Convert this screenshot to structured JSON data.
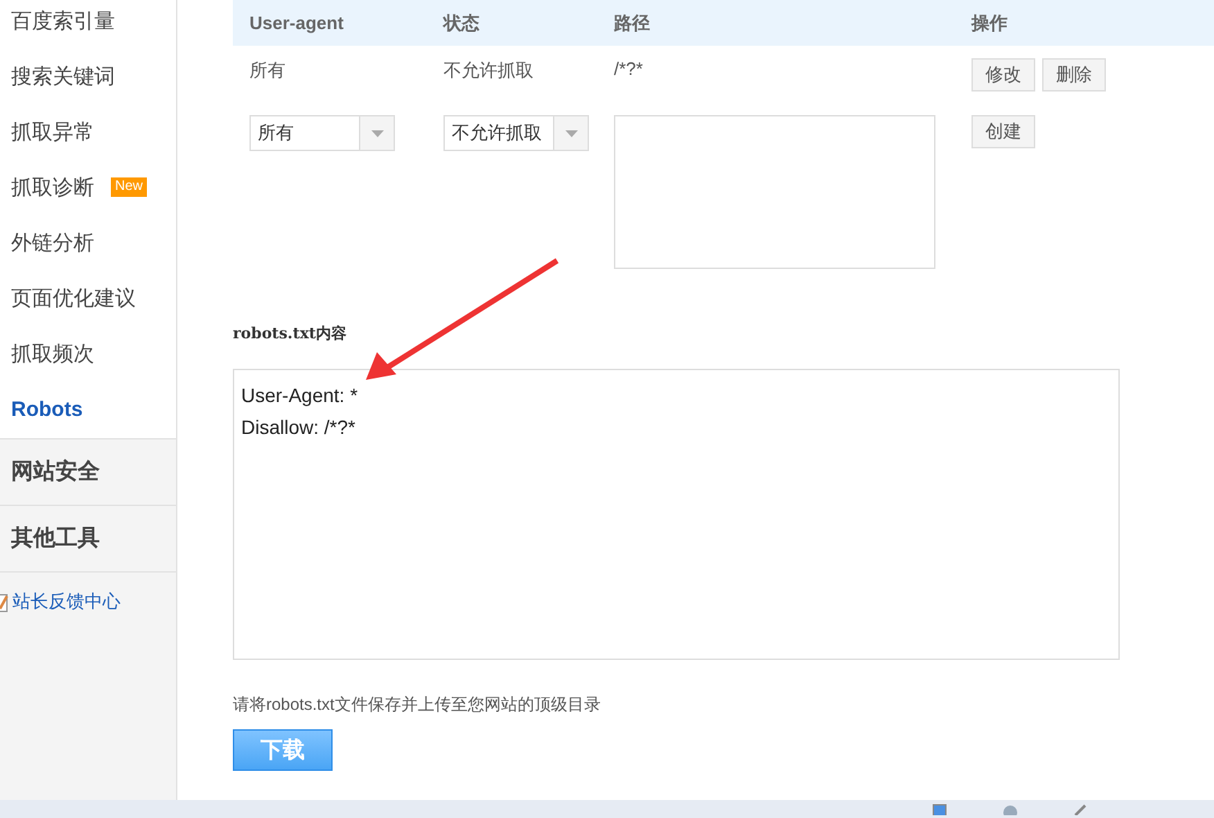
{
  "sidebar": {
    "items": [
      {
        "label": "百度索引量",
        "selected": false
      },
      {
        "label": "搜索关键词",
        "selected": false
      },
      {
        "label": "抓取异常",
        "selected": false
      },
      {
        "label": "抓取诊断",
        "selected": false,
        "badge": "New"
      },
      {
        "label": "外链分析",
        "selected": false
      },
      {
        "label": "页面优化建议",
        "selected": false
      },
      {
        "label": "抓取频次",
        "selected": false
      },
      {
        "label": "Robots",
        "selected": true
      }
    ],
    "groups": [
      "网站安全",
      "其他工具"
    ],
    "feedback_link": "站长反馈中心"
  },
  "table": {
    "columns": [
      "User-agent",
      "状态",
      "路径",
      "操作"
    ],
    "rows": [
      {
        "user_agent": "所有",
        "status": "不允许抓取",
        "path": "/*?*",
        "actions": [
          "修改",
          "删除"
        ]
      }
    ],
    "new_row": {
      "user_agent_select": "所有",
      "status_select": "不允许抓取",
      "create_button": "创建"
    }
  },
  "robots_section": {
    "title": "robots.txt内容",
    "lines": [
      "User-Agent: *",
      "Disallow: /*?*"
    ],
    "instruction": "请将robots.txt文件保存并上传至您网站的顶级目录",
    "download_button": "下载"
  }
}
